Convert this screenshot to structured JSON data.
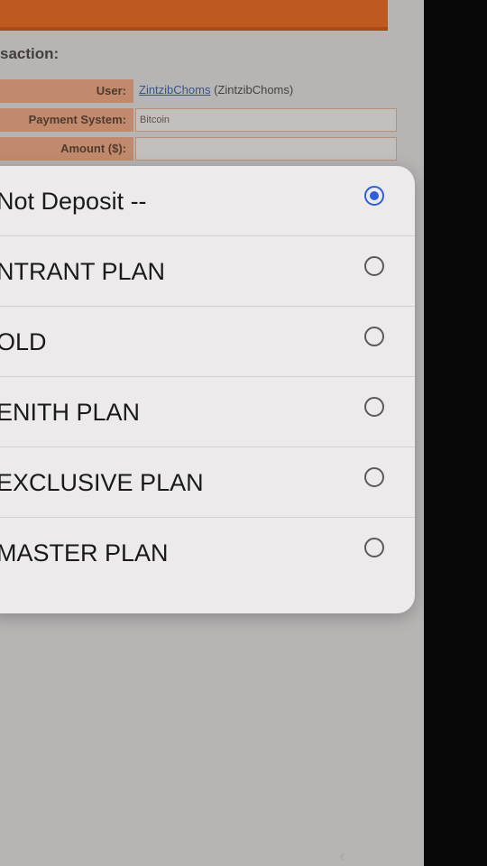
{
  "page": {
    "heading": "saction:"
  },
  "form": {
    "user_label": "User:",
    "user_link": "ZintzibChoms",
    "user_alias": "(ZintzibChoms)",
    "payment_label": "Payment System:",
    "payment_value": "Bitcoin",
    "amount_label": "Amount ($):",
    "amount_value": ""
  },
  "dialog": {
    "options": [
      {
        "label": "Not Deposit --",
        "selected": true
      },
      {
        "label": "NTRANT PLAN",
        "selected": false
      },
      {
        "label": "OLD",
        "selected": false
      },
      {
        "label": "ENITH PLAN",
        "selected": false
      },
      {
        "label": "EXCLUSIVE PLAN",
        "selected": false
      },
      {
        "label": "MASTER PLAN",
        "selected": false
      }
    ]
  },
  "colors": {
    "accent_orange": "#e0661f",
    "radio_selected": "#2f5fd8"
  },
  "icons": {
    "back": "chevron-left-icon",
    "radio_on": "radio-selected-icon",
    "radio_off": "radio-unselected-icon"
  }
}
